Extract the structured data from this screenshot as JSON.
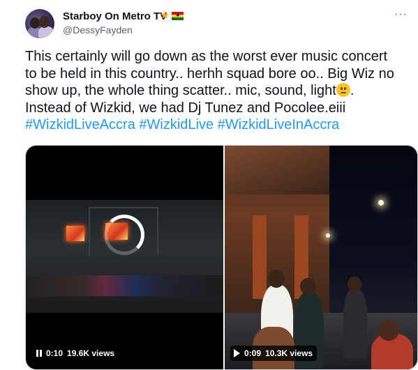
{
  "author": {
    "display_name": "Starboy On Metro TV",
    "handle": "@DessyFayden",
    "badges": [
      "star-icon",
      "ghana-flag-icon"
    ]
  },
  "colors": {
    "link": "#1d9bf0",
    "text": "#0f1419",
    "muted": "#536471",
    "ghana_red": "#ce1126",
    "ghana_gold": "#fcd116",
    "ghana_green": "#006b3f"
  },
  "tweet": {
    "line1": "This certainly will go down as the worst ever music concert",
    "line2": "to be held in this country.. herhh squad bore oo.. Big Wiz no",
    "line3_before": "show up, the whole thing scatter.. mic, sound, light",
    "line3_emoji": "confused-face-emoji",
    "line3_after": ".",
    "line4": "Instead of Wizkid, we had Dj Tunez and Pocolee.eiii",
    "hashtags": [
      "#WizkidLiveAccra",
      "#WizkidLive",
      "#WizkidLiveInAccra"
    ]
  },
  "videos": [
    {
      "state": "playing",
      "control_icon": "pause-icon",
      "time": "0:10",
      "views": "19.6K views",
      "loading": true
    },
    {
      "state": "paused",
      "control_icon": "play-icon",
      "time": "0:09",
      "views": "10.3K views"
    }
  ]
}
